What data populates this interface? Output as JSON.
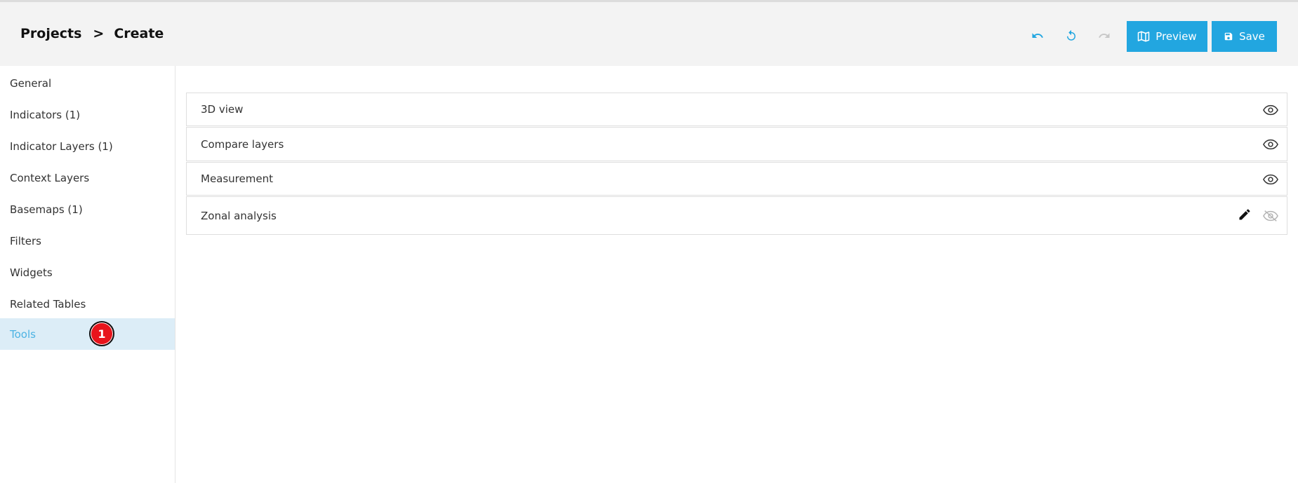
{
  "header": {
    "breadcrumb": {
      "root": "Projects",
      "separator": ">",
      "current": "Create"
    },
    "undo_icon": "undo-icon",
    "reset_icon": "reset-icon",
    "redo_icon": "redo-icon",
    "preview_label": "Preview",
    "save_label": "Save"
  },
  "sidebar": {
    "items": [
      {
        "label": "General"
      },
      {
        "label": "Indicators (1)"
      },
      {
        "label": "Indicator Layers (1)"
      },
      {
        "label": "Context Layers"
      },
      {
        "label": "Basemaps (1)"
      },
      {
        "label": "Filters"
      },
      {
        "label": "Widgets"
      },
      {
        "label": "Related Tables"
      },
      {
        "label": "Tools",
        "active": true
      }
    ],
    "step_badge": "1"
  },
  "tools": [
    {
      "label": "3D view",
      "visible": true
    },
    {
      "label": "Compare layers",
      "visible": true
    },
    {
      "label": "Measurement",
      "visible": true
    },
    {
      "label": "Zonal analysis",
      "visible": false,
      "editable": true
    }
  ],
  "colors": {
    "accent": "#22a6e0",
    "active_bg": "#dcedf7",
    "active_text": "#4cb3e3",
    "badge": "#e8141c"
  }
}
